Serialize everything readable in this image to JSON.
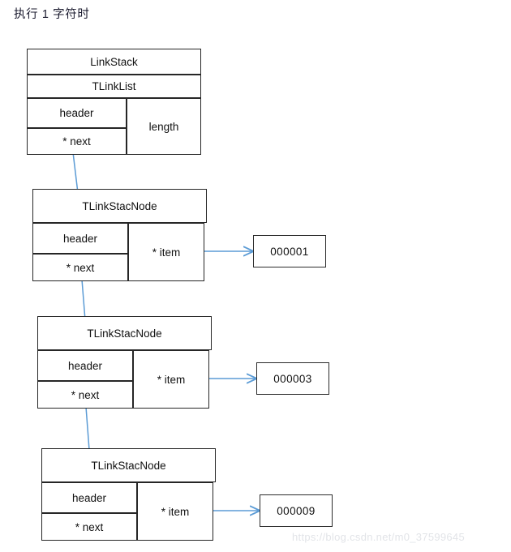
{
  "caption": {
    "text": "执行 1 字符时"
  },
  "colors": {
    "box_border": "#262626",
    "connector": "#5B9BD5",
    "text": "#111111",
    "watermark": "#e2e4e8",
    "background": "#ffffff"
  },
  "struct_box": {
    "class_name": "LinkStack",
    "base_name": "TLinkList",
    "fields": {
      "header": "header",
      "next": "* next",
      "length": "length"
    }
  },
  "nodes": [
    {
      "title": "TLinkStacNode",
      "header_label": "header",
      "item_label": "* item",
      "next_label": "* next",
      "value": "000001"
    },
    {
      "title": "TLinkStacNode",
      "header_label": "header",
      "item_label": "* item",
      "next_label": "* next",
      "value": "000003"
    },
    {
      "title": "TLinkStacNode",
      "header_label": "header",
      "item_label": "* item",
      "next_label": "* next",
      "value": "000009"
    }
  ],
  "watermark": {
    "text": "https://blog.csdn.net/m0_37599645"
  }
}
